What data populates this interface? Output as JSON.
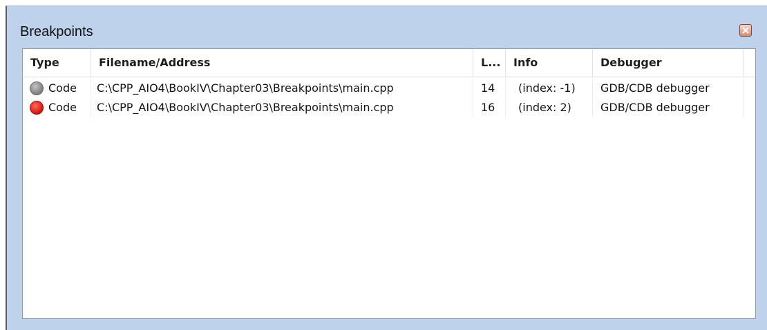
{
  "window": {
    "title": "Breakpoints",
    "close_icon": "close-icon",
    "accent_color": "#bed2eb"
  },
  "columns": [
    "Type",
    "Filename/Address",
    "L...",
    "Info",
    "Debugger"
  ],
  "rows": [
    {
      "status_icon": "breakpoint-disabled-icon",
      "status_color": "#8a8a8a",
      "type": "Code",
      "filename": "C:\\CPP_AIO4\\BookIV\\Chapter03\\Breakpoints\\main.cpp",
      "line": "14",
      "info": "(index: -1)",
      "debugger": "GDB/CDB debugger"
    },
    {
      "status_icon": "breakpoint-enabled-icon",
      "status_color": "#e0160e",
      "type": "Code",
      "filename": "C:\\CPP_AIO4\\BookIV\\Chapter03\\Breakpoints\\main.cpp",
      "line": "16",
      "info": "(index: 2)",
      "debugger": "GDB/CDB debugger"
    }
  ]
}
